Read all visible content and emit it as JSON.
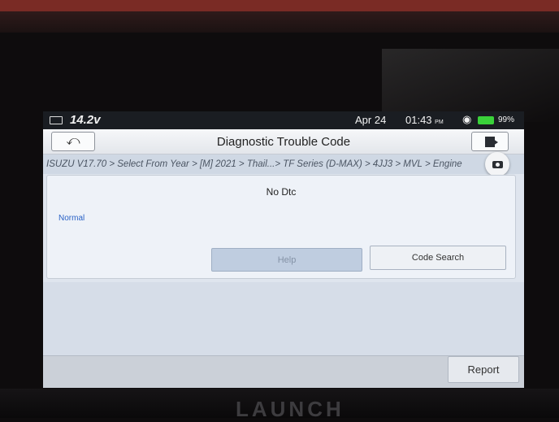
{
  "status_bar": {
    "voltage": "14.2v",
    "date": "Apr 24",
    "time": "01:43",
    "time_suffix": "PM",
    "battery_percent": "99%",
    "wifi_icon": "wifi-icon",
    "battery_color": "#3ad13a"
  },
  "header": {
    "title": "Diagnostic Trouble Code",
    "back_icon": "back-arrow-icon",
    "exit_icon": "exit-icon"
  },
  "breadcrumb": "ISUZU V17.70 > Select From Year > [M] 2021 > Thail...> TF Series (D-MAX) > 4JJ3 > MVL > Engine",
  "result": {
    "message": "No Dtc",
    "status": "Normal",
    "status_color": "#2b63c6"
  },
  "buttons": {
    "help": "Help",
    "code_search": "Code Search",
    "report": "Report"
  },
  "device": {
    "brand": "LAUNCH"
  }
}
